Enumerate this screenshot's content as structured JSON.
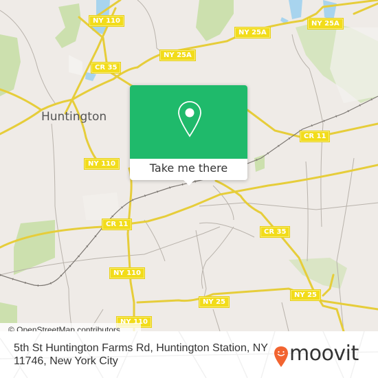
{
  "map": {
    "place_labels": [
      {
        "name": "huntington-label",
        "text": "Huntington"
      }
    ],
    "route_shields": [
      {
        "text": "NY 110"
      },
      {
        "text": "NY 25A"
      },
      {
        "text": "NY 25A"
      },
      {
        "text": "NY 25A"
      },
      {
        "text": "CR 35"
      },
      {
        "text": "CR 11"
      },
      {
        "text": "NY 110"
      },
      {
        "text": "CR 11"
      },
      {
        "text": "CR 35"
      },
      {
        "text": "NY 110"
      },
      {
        "text": "NY 25"
      },
      {
        "text": "NY 25"
      },
      {
        "text": "NY 110"
      }
    ],
    "attribution": "© OpenStreetMap contributors",
    "colors": {
      "land": "#efebe7",
      "park": "#c8dfa8",
      "water": "#a8d4ee",
      "road": "#f2dc1a",
      "minor_road": "#b8b2ab"
    }
  },
  "popup": {
    "icon": "location-pin-icon",
    "button_label": "Take me there",
    "accent_color": "#1fba6b"
  },
  "footer": {
    "address": "5th St Huntington Farms Rd, Huntington Station, NY 11746, New York City",
    "brand": "moovit",
    "brand_color": "#f26430"
  }
}
